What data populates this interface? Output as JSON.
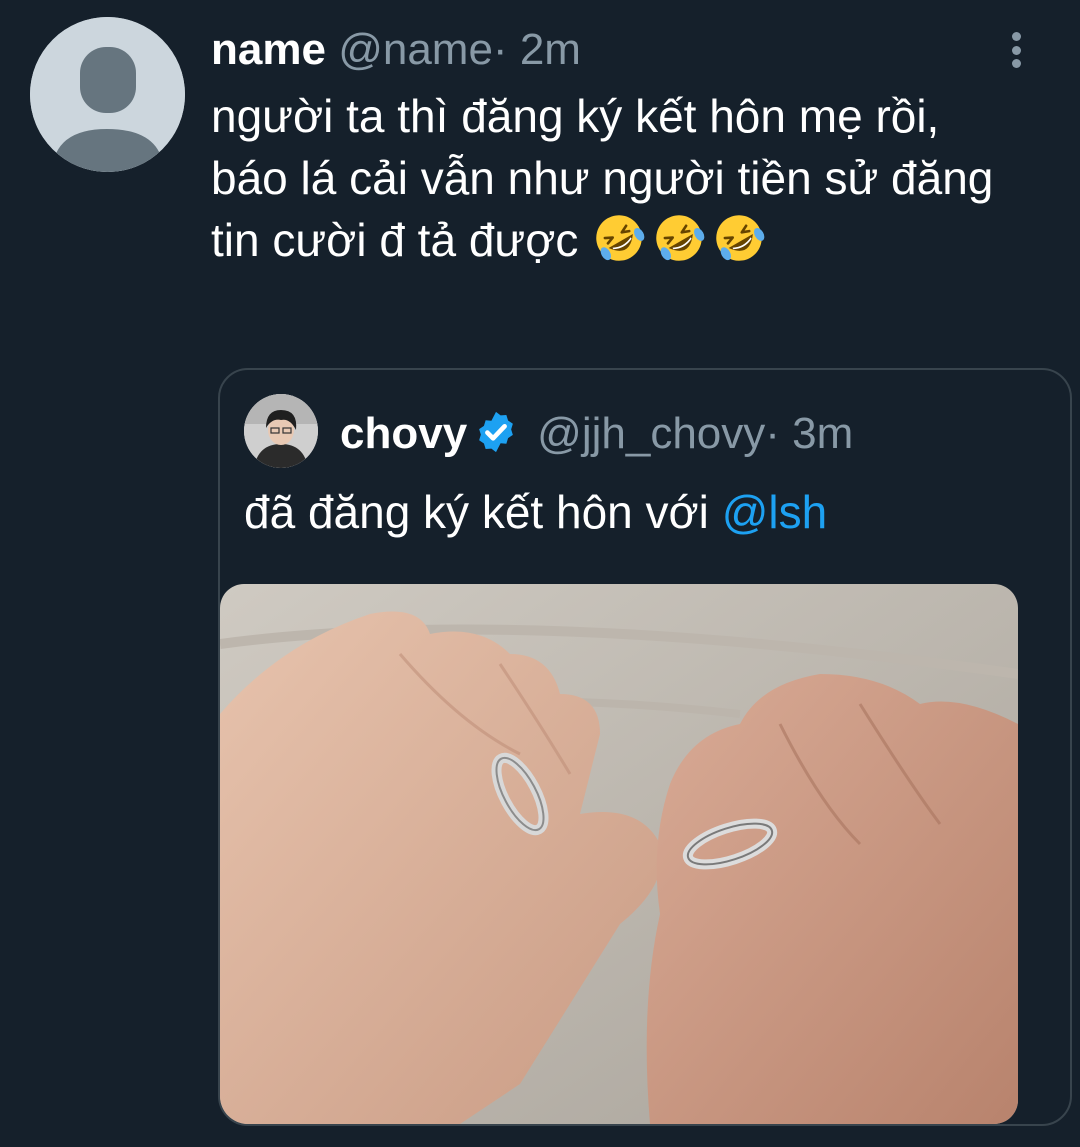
{
  "tweet": {
    "name": "name",
    "handle": "@name",
    "separator": "·",
    "time": "2m",
    "text": "người ta thì đăng ký kết hôn mẹ rồi, báo lá cải vẫn như người tiền sử đăng tin cười đ tả được",
    "emoji": [
      "rolling-on-floor-laughing",
      "rolling-on-floor-laughing",
      "rolling-on-floor-laughing"
    ],
    "more_icon": "vertical-ellipsis-icon"
  },
  "quoted": {
    "name": "chovy",
    "verified": true,
    "handle": "@jjh_chovy",
    "separator": "·",
    "time": "3m",
    "text": "đã đăng ký kết hôn với ",
    "mention": "@lsh",
    "image": "photo of two hands wearing matching rings"
  },
  "colors": {
    "background": "#15202b",
    "secondary_text": "#8899a6",
    "link": "#1da1f2",
    "border": "#38444d"
  }
}
